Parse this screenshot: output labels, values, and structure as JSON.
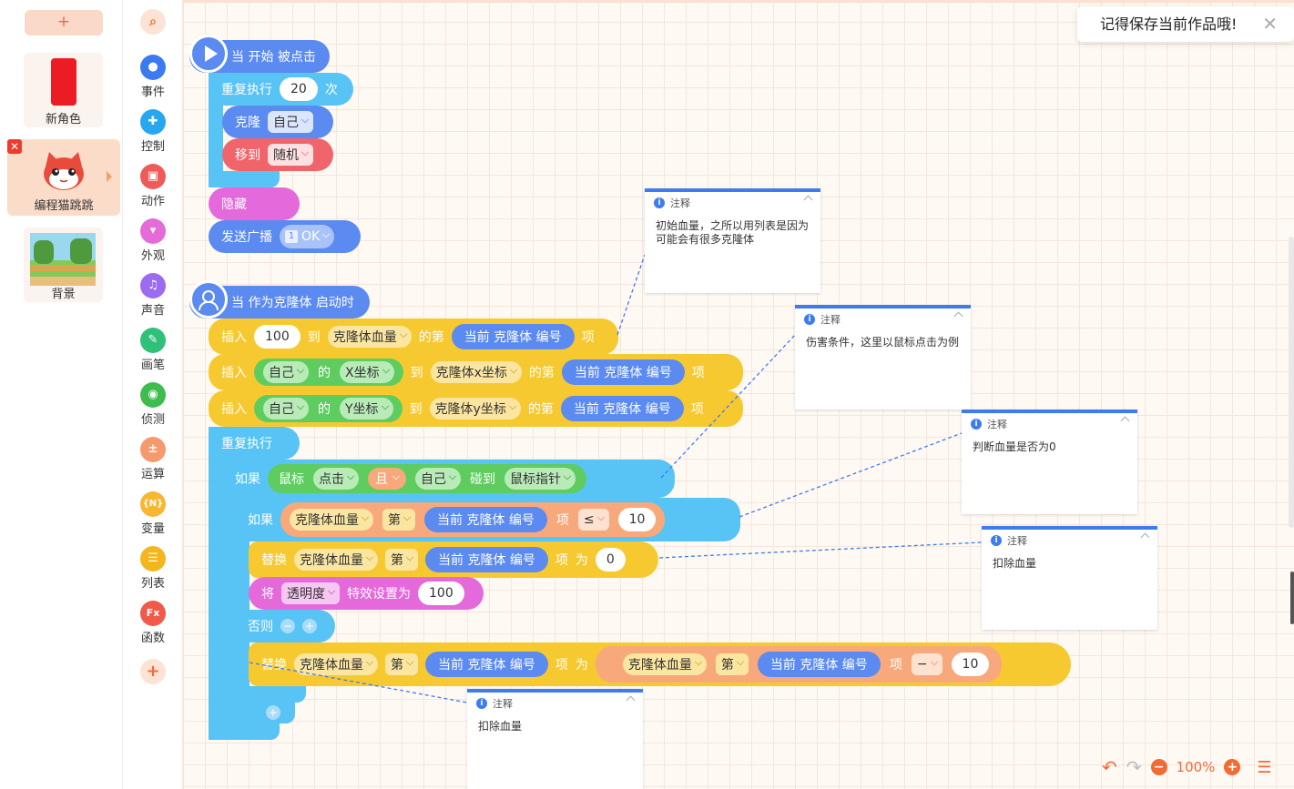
{
  "sprites": {
    "add": "+",
    "items": [
      {
        "label": "新角色"
      },
      {
        "label": "编程猫跳跳"
      },
      {
        "label": "背景"
      }
    ]
  },
  "categories": [
    {
      "name": "事件",
      "color": "#3b7af0",
      "icon": "event-icon"
    },
    {
      "name": "控制",
      "color": "#26a7ef",
      "icon": "control-icon"
    },
    {
      "name": "动作",
      "color": "#ef5a5a",
      "icon": "motion-icon"
    },
    {
      "name": "外观",
      "color": "#e46bd8",
      "icon": "looks-icon"
    },
    {
      "name": "声音",
      "color": "#9b6bf0",
      "icon": "sound-icon"
    },
    {
      "name": "画笔",
      "color": "#2fc07a",
      "icon": "pen-icon"
    },
    {
      "name": "侦测",
      "color": "#3fbc4e",
      "icon": "sensing-icon"
    },
    {
      "name": "运算",
      "color": "#f59a6f",
      "icon": "operator-icon"
    },
    {
      "name": "变量",
      "color": "#f7b733",
      "icon": "variable-icon"
    },
    {
      "name": "列表",
      "color": "#f3b61f",
      "icon": "list-icon"
    },
    {
      "name": "函数",
      "color": "#f05a48",
      "icon": "function-icon"
    }
  ],
  "toast": {
    "text": "记得保存当前作品哦!",
    "close": "✕"
  },
  "zoom": {
    "level": "100%"
  },
  "script1": {
    "hat": "当 开始 被点击",
    "repeat": "重复执行",
    "repeat_count": "20",
    "times": "次",
    "clone": "克隆",
    "clone_target": "自己",
    "move_to": "移到",
    "move_target": "随机",
    "hide": "隐藏",
    "broadcast": "发送广播",
    "broadcast_msg": "OK",
    "broadcast_badge": "1"
  },
  "script2": {
    "hat": "当 作为克隆体 启动时",
    "insert": "插入",
    "to": "到",
    "of_the": "的第",
    "item": "项",
    "of": "的",
    "hp_list": "克隆体血量",
    "x_list": "克隆体x坐标",
    "y_list": "克隆体y坐标",
    "clone_index": "当前 克隆体 编号",
    "val100": "100",
    "self": "自己",
    "x_prop": "X坐标",
    "y_prop": "Y坐标",
    "forever": "重复执行",
    "if": "如果",
    "mouse": "鼠标",
    "click": "点击",
    "and": "且",
    "touch": "碰到",
    "pointer": "鼠标指针",
    "nth": "第",
    "lte": "≤",
    "ten": "10",
    "replace": "替换",
    "as": "为",
    "zero": "0",
    "set": "将",
    "opacity": "透明度",
    "effect_to": "特效设置为",
    "else": "否则",
    "minus": "−",
    "ctl_minus": "−",
    "ctl_plus": "+"
  },
  "notes": {
    "title": "注释",
    "n1": "初始血量，之所以用列表是因为可能会有很多克隆体",
    "n2": "伤害条件，这里以鼠标点击为例",
    "n3": "判断血量是否为0",
    "n4": "扣除血量",
    "n5": "扣除血量"
  }
}
